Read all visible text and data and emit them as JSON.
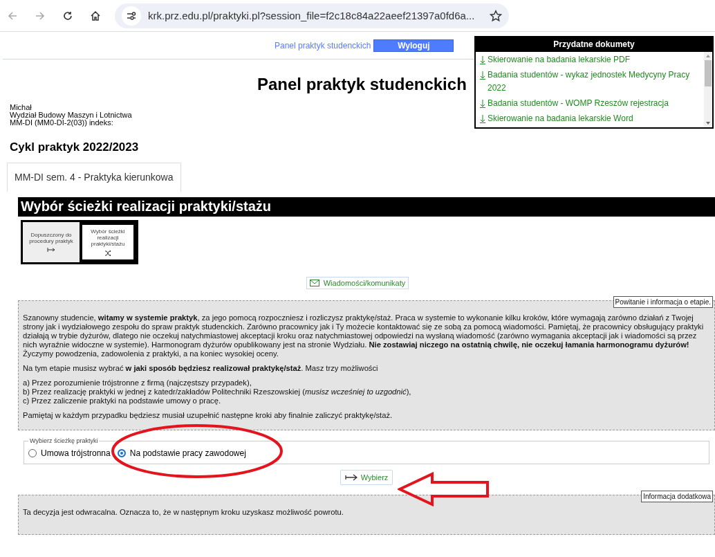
{
  "browser": {
    "url": "krk.prz.edu.pl/praktyki.pl?session_file=f2c18c84a22aeef21397a0fd6a..."
  },
  "top_nav": {
    "link": "Panel praktyk studenckich",
    "logout": "Wyloguj"
  },
  "documents": {
    "title": "Przydatne dokumety",
    "items": [
      "Skierowanie na badania lekarskie PDF",
      "Badania studentów - wykaz jednostek Medycyny Pracy 2022",
      "Badania studentów - WOMP Rzeszów rejestracja",
      "Skierowanie na badania lekarskie Word"
    ]
  },
  "page_title": "Panel praktyk studenckich",
  "student": [
    "Michał",
    "Wydział Budowy Maszyn i Lotnictwa",
    "MM-DI (MM0-DI-2(03)) indeks:"
  ],
  "cycle": "Cykl praktyk 2022/2023",
  "tabs": [
    {
      "label": "MM-DI sem. 4 - Praktyka kierunkowa",
      "selected": true
    }
  ],
  "section_title": "Wybór ścieżki realizacji praktyki/stażu",
  "steps": [
    {
      "label": "Dopuszczony do procedury praktyk",
      "selected": false
    },
    {
      "label": "Wybór ścieżki realizacji praktyki/stażu",
      "selected": true
    }
  ],
  "messages_button": "Wiadomości/komunikaty",
  "welcome": {
    "legend": "Powitanie i informacja o etapie.",
    "paragraphs": [
      "Szanowny studencie, **witamy w systemie praktyk**, za jego pomocą rozpoczniesz i rozliczysz praktykę/staż. Praca w systemie to wykonanie kilku kroków, które wymagają zarówno działań z Twojej strony jak i wydziałowego zespołu do spraw praktyk studenckich. Zarówno pracownicy jak i Ty możecie kontaktować się ze sobą za pomocą wiadomości. Pamiętaj, że pracownicy obsługujący praktyki działają w trybie dyżurów, dlatego nie oczekuj natychmiastowej akceptacji kroku oraz natychmiastowej odpowiedzi na wysłaną wiadomość (zarówno wymagania akceptacji jak i wiadomości są przez nich wyraźnie widoczne w systemie). Harmonogram dyżurów opublikowany jest na stronie Wydziału. **Nie zostawiaj niczego na ostatnią chwilę, nie oczekuj łamania harmonogramu dyżurów!** Życzymy powodzenia, zadowolenia z praktyki, a na koniec wysokiej oceny.",
      "Na tym etapie musisz wybrać **w jaki sposób będziesz realizował praktykę/staż**. Masz trzy możliwości"
    ],
    "options": [
      "a) Przez porozumienie trójstronne z firmą (najczęstszy przypadek),",
      "b) Przez realizację praktyki w jednej z katedr/zakładów Politechniki Rzeszowskiej (*musisz wcześniej to uzgodnić*),",
      "c) Przez zaliczenie praktyki na podstawie umowy o pracę."
    ],
    "closing": "Pamiętaj w każdym przypadku będziesz musiał uzupełnić następne kroki aby finalnie zaliczyć praktykę/staż."
  },
  "path_choice": {
    "legend": "Wybierz ścieżkę praktyki",
    "options": [
      {
        "label": "Umowa trójstronna",
        "selected": false
      },
      {
        "label": "Na podstawie pracy zawodowej",
        "selected": true
      }
    ]
  },
  "submit": "Wybierz",
  "extra": {
    "legend": "Informacja dodatkowa",
    "text": "Ta decyzja jest odwracalna. Oznacza to, że w następnym kroku uzyskasz możliwość powrotu."
  }
}
